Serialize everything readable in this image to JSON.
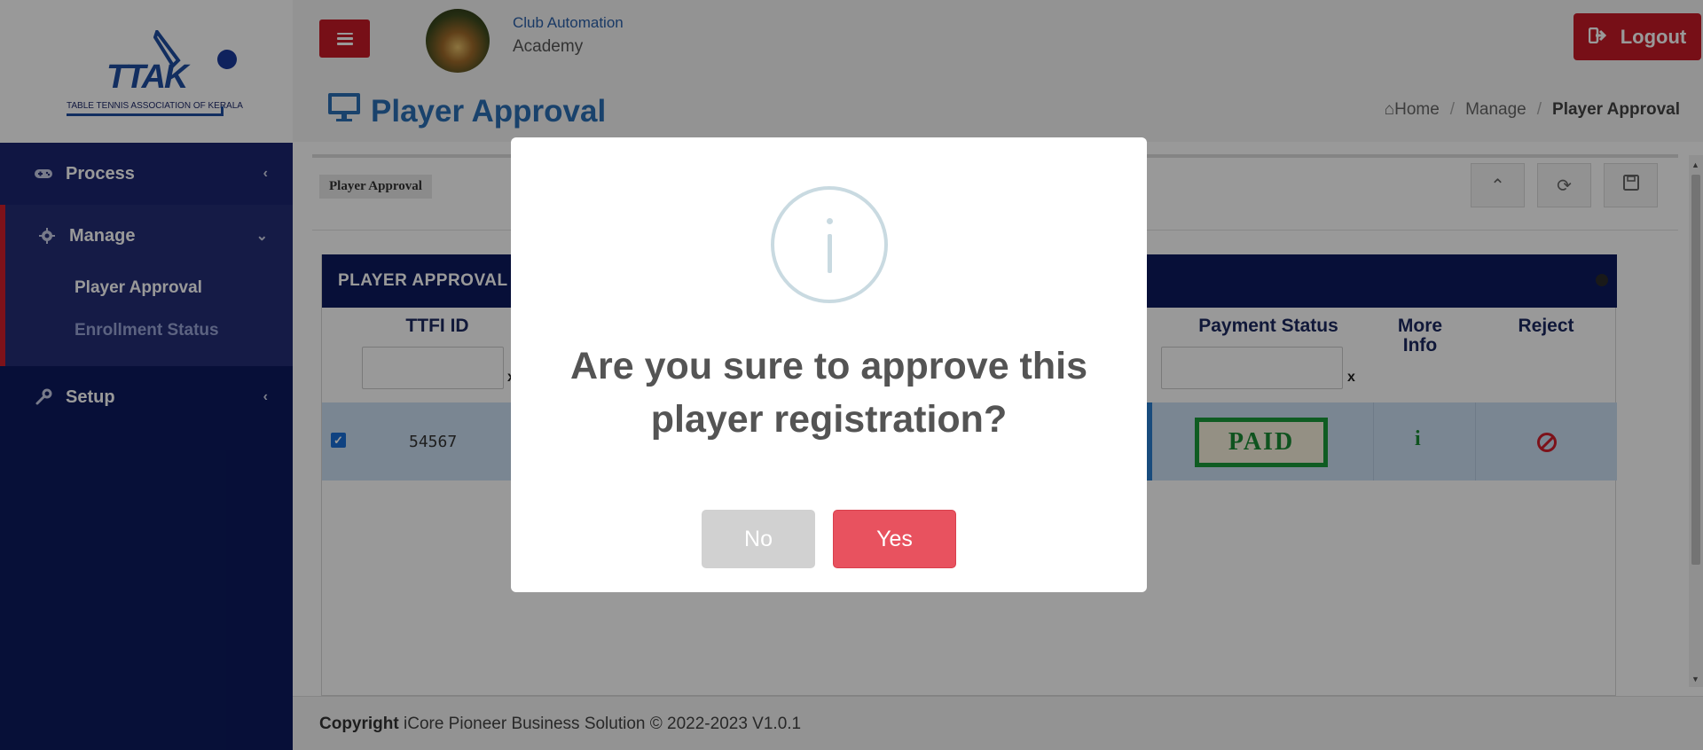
{
  "brand": {
    "logo_letters": "TTAK",
    "logo_caption": "TABLE TENNIS ASSOCIATION OF KERALA"
  },
  "sidebar": {
    "items": [
      {
        "label": "Process",
        "icon": "gamepad-icon",
        "expanded": false
      },
      {
        "label": "Manage",
        "icon": "gear-icon",
        "expanded": true,
        "children": [
          {
            "label": "Player Approval",
            "active": true
          },
          {
            "label": "Enrollment Status",
            "active": false
          }
        ]
      },
      {
        "label": "Setup",
        "icon": "wrench-icon",
        "expanded": false
      }
    ]
  },
  "header": {
    "club_name": "Club Automation",
    "club_subtitle": "Academy",
    "logout_label": "Logout",
    "accent_color": "#c71a27"
  },
  "page": {
    "title": "Player Approval",
    "breadcrumb": [
      "Home",
      "Manage",
      "Player Approval"
    ]
  },
  "toolbar": {
    "tab_label": "Player Approval"
  },
  "grid": {
    "title": "PLAYER APPROVAL",
    "columns": {
      "ttfi_id": "TTFI ID",
      "payment_status": "Payment Status",
      "more_info_line1": "More",
      "more_info_line2": "Info",
      "reject": "Reject"
    },
    "filter_clear": "x",
    "rows": [
      {
        "ttfi_id": "54567",
        "selected": true,
        "payment_status": "PAID",
        "more_info": "i"
      }
    ]
  },
  "footer": {
    "bold": "Copyright",
    "text": " iCore Pioneer Business Solution © 2022-2023 V1.0.1"
  },
  "dialog": {
    "message": "Are you sure to approve this player registration?",
    "no_label": "No",
    "yes_label": "Yes",
    "yes_color": "#e8525f"
  }
}
